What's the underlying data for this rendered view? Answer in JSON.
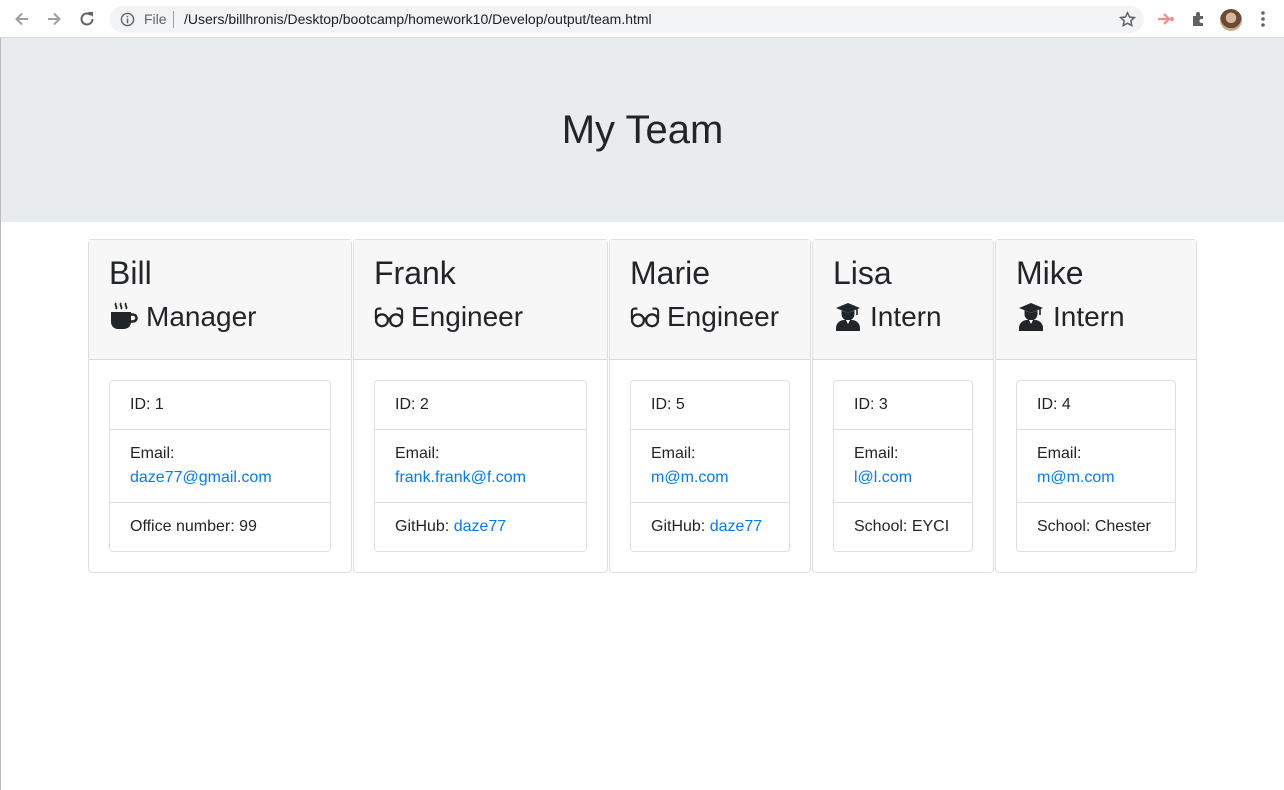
{
  "browser": {
    "file_label": "File",
    "url": "/Users/billhronis/Desktop/bootcamp/homework10/Develop/output/team.html"
  },
  "page": {
    "title": "My Team"
  },
  "labels": {
    "id_prefix": "ID: ",
    "email_label": "Email:",
    "office_prefix": "Office number: ",
    "github_prefix": "GitHub: ",
    "school_prefix": "School: "
  },
  "team": [
    {
      "name": "Bill",
      "role": "Manager",
      "icon": "coffee-icon",
      "id": "1",
      "email": "daze77@gmail.com",
      "office": "99"
    },
    {
      "name": "Frank",
      "role": "Engineer",
      "icon": "glasses-icon",
      "id": "2",
      "email": "frank.frank@f.com",
      "github": "daze77"
    },
    {
      "name": "Marie",
      "role": "Engineer",
      "icon": "glasses-icon",
      "id": "5",
      "email": "m@m.com",
      "github": "daze77"
    },
    {
      "name": "Lisa",
      "role": "Intern",
      "icon": "graduate-icon",
      "id": "3",
      "email": "l@l.com",
      "school": "EYCI"
    },
    {
      "name": "Mike",
      "role": "Intern",
      "icon": "graduate-icon",
      "id": "4",
      "email": "m@m.com",
      "school": "Chester"
    }
  ],
  "colors": {
    "jumbotron": "#e9ecef",
    "link": "#007bff",
    "card_header": "#f7f7f7"
  }
}
